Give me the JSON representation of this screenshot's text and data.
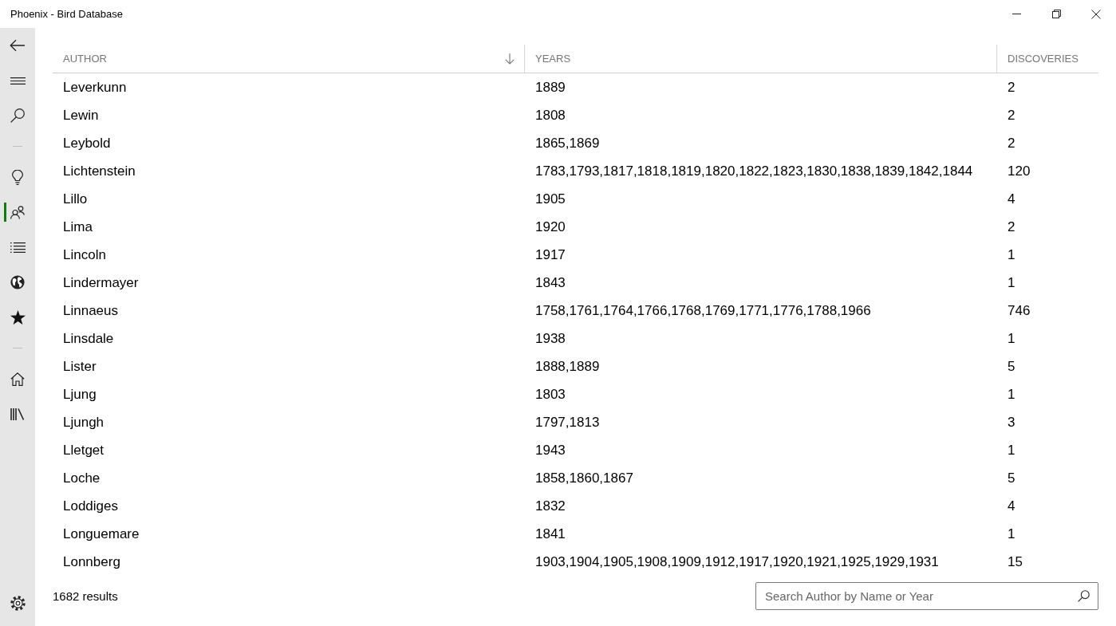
{
  "window": {
    "title": "Phoenix - Bird Database"
  },
  "sidebar": {
    "top_items": [
      {
        "kind": "button",
        "selected": false
      },
      {
        "kind": "button",
        "selected": false
      },
      {
        "kind": "button",
        "selected": false
      },
      {
        "kind": "separator"
      },
      {
        "kind": "button",
        "selected": false
      },
      {
        "kind": "button",
        "selected": true
      },
      {
        "kind": "button",
        "selected": false
      },
      {
        "kind": "button",
        "selected": false
      },
      {
        "kind": "button",
        "selected": false
      },
      {
        "kind": "separator"
      },
      {
        "kind": "button",
        "selected": false
      },
      {
        "kind": "button",
        "selected": false
      }
    ],
    "bottom_items": [
      {
        "kind": "button",
        "selected": false
      }
    ]
  },
  "table": {
    "columns": [
      {
        "label": "AUTHOR",
        "sorted": true
      },
      {
        "label": "YEARS",
        "sorted": false
      },
      {
        "label": "DISCOVERIES",
        "sorted": false
      }
    ],
    "rows": [
      {
        "author": "Leverkunn",
        "years": "1889",
        "discoveries": "2"
      },
      {
        "author": "Lewin",
        "years": "1808",
        "discoveries": "2"
      },
      {
        "author": "Leybold",
        "years": "1865,1869",
        "discoveries": "2"
      },
      {
        "author": "Lichtenstein",
        "years": "1783,1793,1817,1818,1819,1820,1822,1823,1830,1838,1839,1842,1844",
        "discoveries": "120"
      },
      {
        "author": "Lillo",
        "years": "1905",
        "discoveries": "4"
      },
      {
        "author": "Lima",
        "years": "1920",
        "discoveries": "2"
      },
      {
        "author": "Lincoln",
        "years": "1917",
        "discoveries": "1"
      },
      {
        "author": "Lindermayer",
        "years": "1843",
        "discoveries": "1"
      },
      {
        "author": "Linnaeus",
        "years": "1758,1761,1764,1766,1768,1769,1771,1776,1788,1966",
        "discoveries": "746"
      },
      {
        "author": "Linsdale",
        "years": "1938",
        "discoveries": "1"
      },
      {
        "author": "Lister",
        "years": "1888,1889",
        "discoveries": "5"
      },
      {
        "author": "Ljung",
        "years": "1803",
        "discoveries": "1"
      },
      {
        "author": "Ljungh",
        "years": "1797,1813",
        "discoveries": "3"
      },
      {
        "author": "Lletget",
        "years": "1943",
        "discoveries": "1"
      },
      {
        "author": "Loche",
        "years": "1858,1860,1867",
        "discoveries": "5"
      },
      {
        "author": "Loddiges",
        "years": "1832",
        "discoveries": "4"
      },
      {
        "author": "Longuemare",
        "years": "1841",
        "discoveries": "1"
      },
      {
        "author": "Lonnberg",
        "years": "1903,1904,1905,1908,1909,1912,1917,1920,1921,1925,1929,1931",
        "discoveries": "15"
      }
    ]
  },
  "footer": {
    "result_count": "1682 results",
    "search": {
      "placeholder": "Search Author by Name or Year"
    }
  }
}
